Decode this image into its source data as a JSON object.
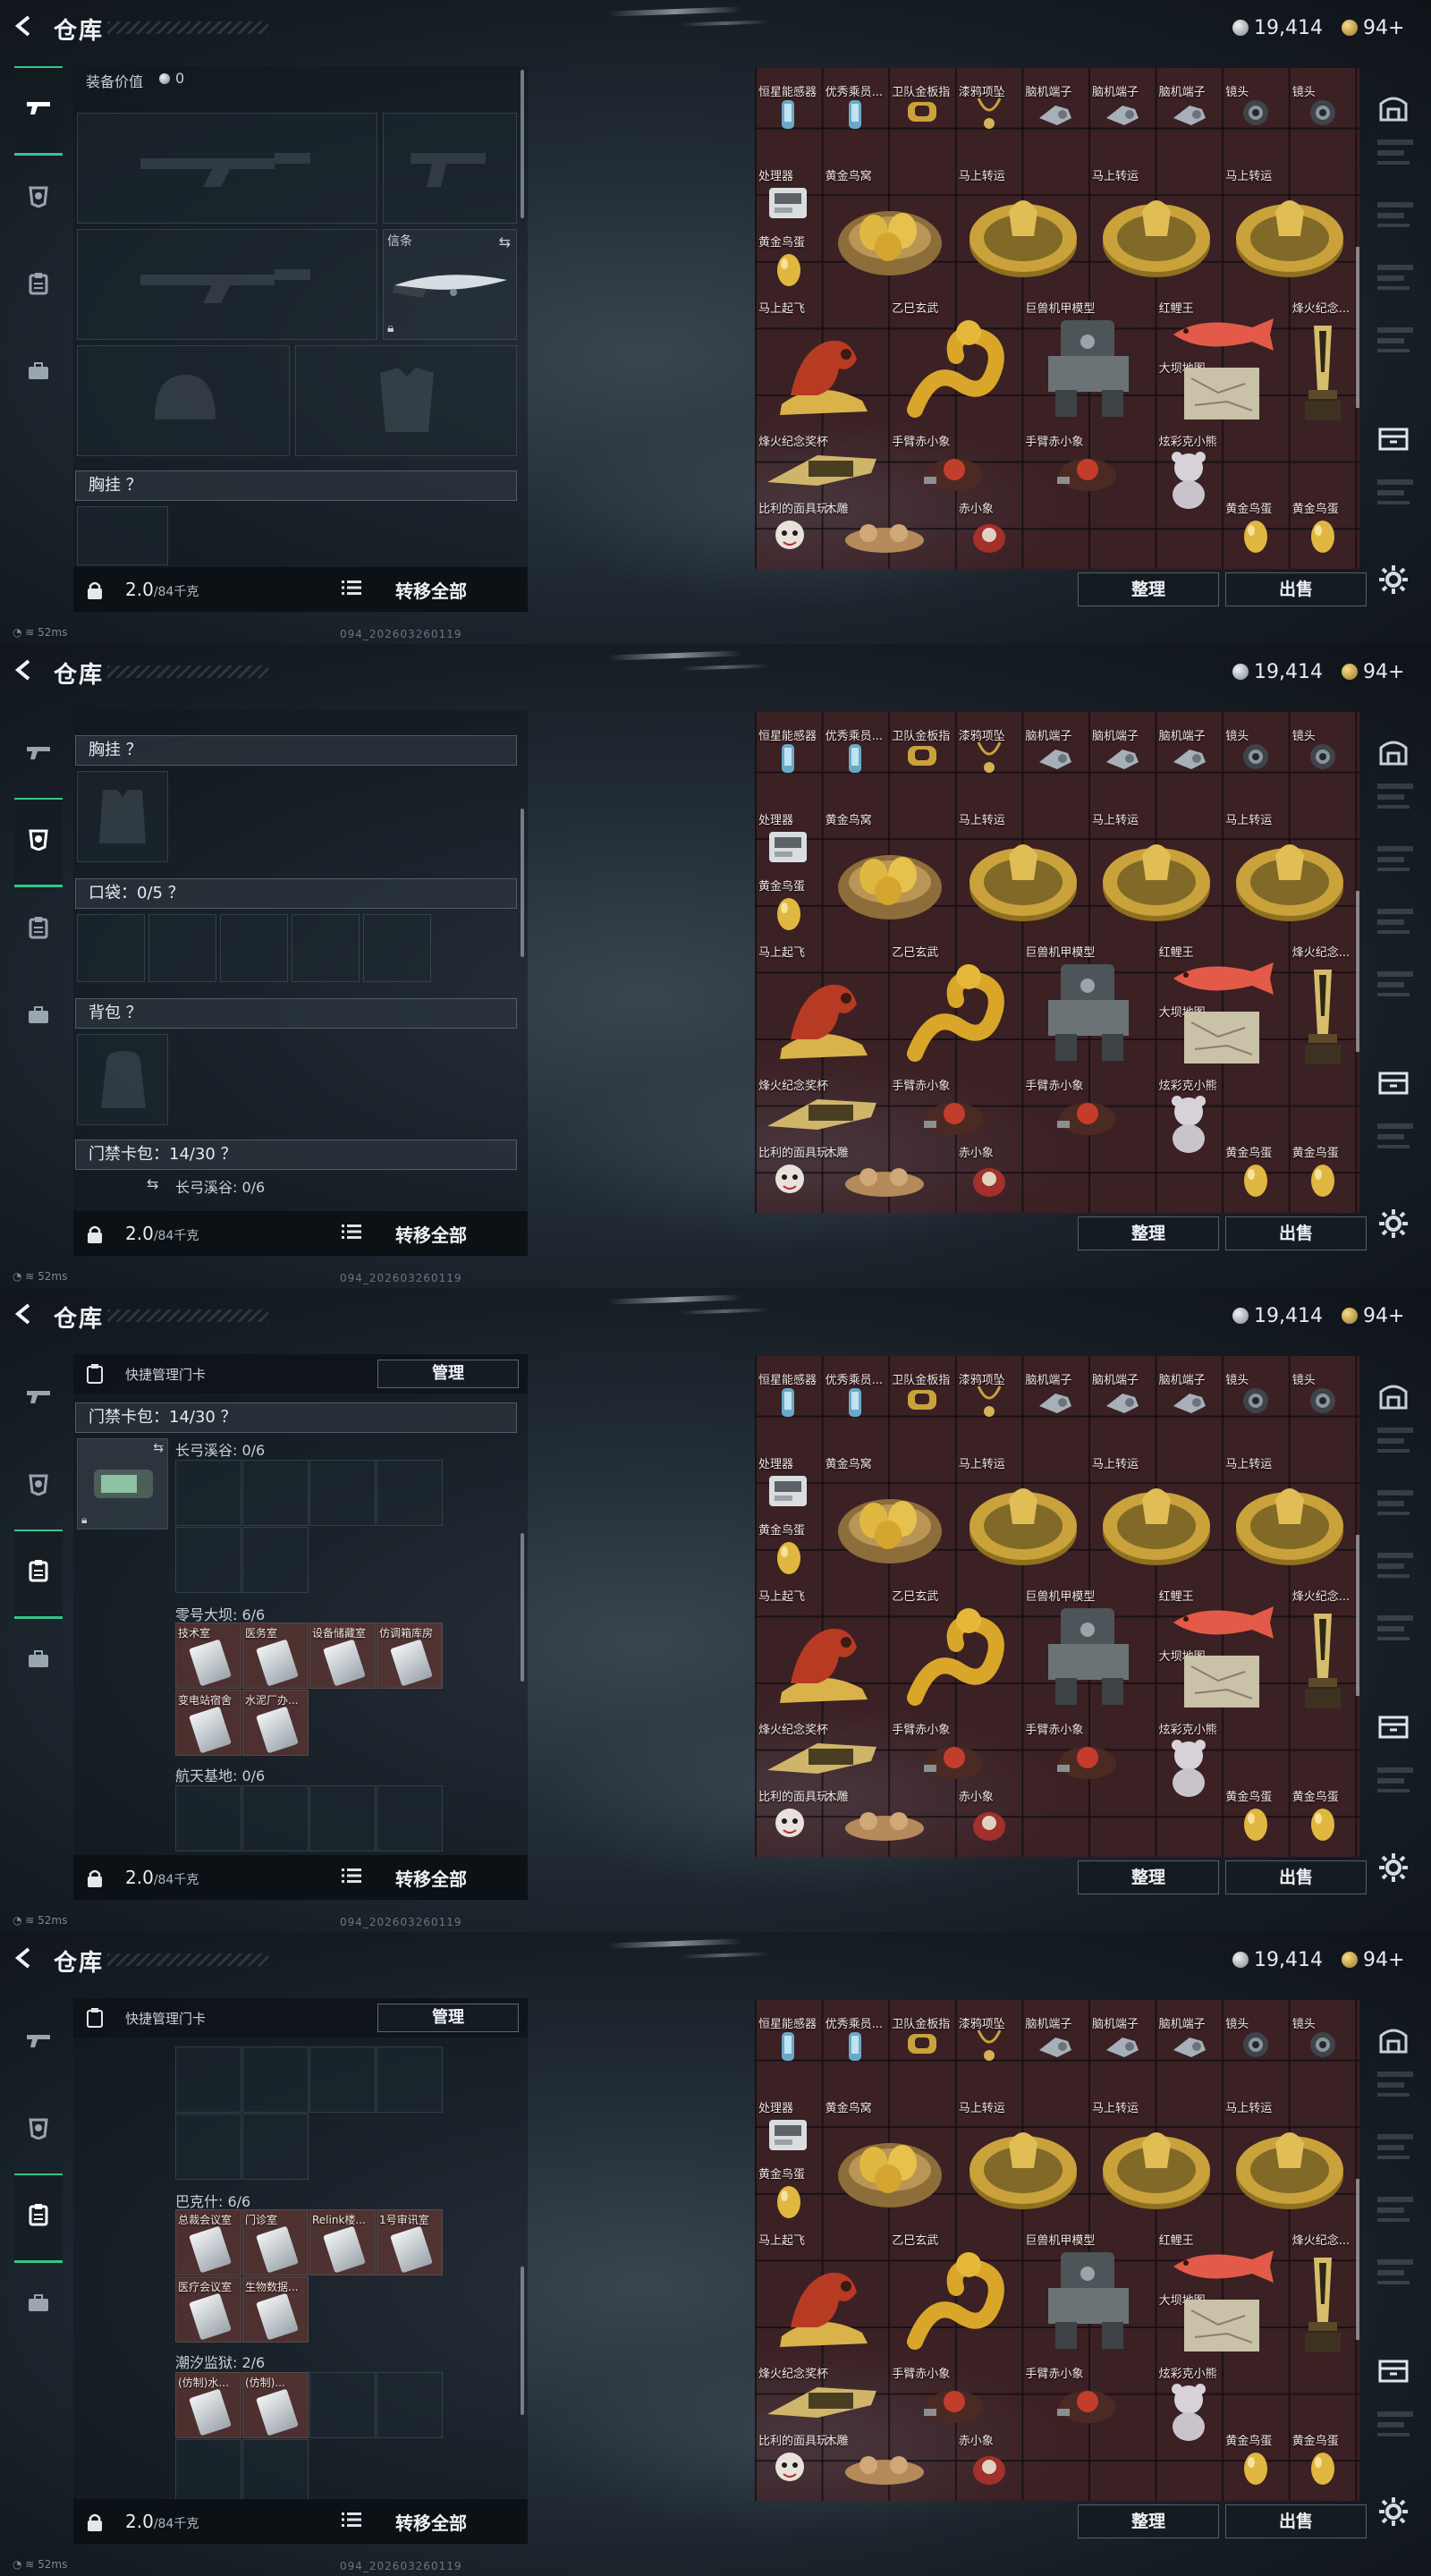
{
  "header": {
    "title": "仓库",
    "silver_amount": "19,414",
    "gold_amount": "94+"
  },
  "left_panel": {
    "equip_value_label": "装备价值",
    "equip_value": "0",
    "knife_label": "信条",
    "chest_rig_label": "胸挂 ？",
    "pocket_label": "口袋：0/5 ？",
    "backpack_label": "背包 ？",
    "keycard_bag_label": "门禁卡包：14/30 ？",
    "quick_manage_label": "快捷管理门卡",
    "manage_button": "管理",
    "maps": {
      "changgong": "长弓溪谷: 0/6",
      "lingda": "零号大坝: 6/6",
      "hangtian": "航天基地: 0/6",
      "bakeshi": "巴克什: 6/6",
      "chaoxi": "潮汐监狱: 2/6"
    },
    "dam_cards": [
      "技术室",
      "医务室",
      "设备储藏室",
      "仿调箱库房",
      "变电站宿舍",
      "水泥厂办..."
    ],
    "bakeshi_cards": [
      "总裁会议室",
      "门诊室",
      "Relink楼...",
      "1号审讯室",
      "医疗会议室",
      "生物数据..."
    ],
    "chaoxi_cards": [
      "(仿制)水...",
      "(仿制)..."
    ]
  },
  "footer": {
    "weight_value": "2.0",
    "weight_capacity": "/84千克",
    "transfer_all": "转移全部"
  },
  "grid_items": {
    "r0": [
      "恒星能感器",
      "优秀乘员...",
      "卫队金板指",
      "漆鸦项坠",
      "脑机端子",
      "脑机端子",
      "脑机端子",
      "镜头",
      "镜头"
    ],
    "processor": "处理器",
    "golden_nest": "黄金鸟窝",
    "horse_luck": "马上转运",
    "golden_egg": "黄金鸟蛋",
    "horse_fly": "马上起飞",
    "yiwu": "乙巳玄武",
    "mech": "巨兽机甲模型",
    "koi": "红鲤王",
    "torch": "烽火纪念...",
    "map_piece": "大坝地图...",
    "torch_cup": "烽火纪念奖杯",
    "hand_xiaoxiang": "手臂赤小象",
    "color_bear": "炫彩克小熊",
    "bili_doll": "比利的面具玩...",
    "wooden": "木雕",
    "red_xiaoxiang": "赤小象"
  },
  "buttons": {
    "sort": "整理",
    "sell": "出售"
  },
  "status": {
    "ping": "52ms",
    "build": "094_202603260119"
  },
  "colors": {
    "accent_green": "#39c38a",
    "grid_bg": "#3b2024",
    "gold": "#c9a23c"
  }
}
